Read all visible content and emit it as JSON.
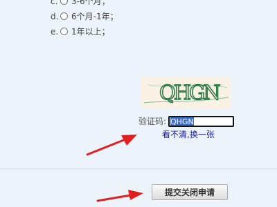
{
  "duration_options": [
    {
      "letter": "c.",
      "label": "3-6个月；"
    },
    {
      "letter": "d.",
      "label": "6个月-1年；"
    },
    {
      "letter": "e.",
      "label": "1年以上；"
    }
  ],
  "captcha": {
    "image_text": "QHGN",
    "label": "验证码:",
    "input_value": "QHGN",
    "refresh_link": "看不清,换一张"
  },
  "actions": {
    "submit_label": "提交关闭申请"
  },
  "colors": {
    "annotation_arrow": "#e02020",
    "captcha_text": "#2f7a46",
    "link": "#1a1ab0",
    "page_background": "#edf3fb"
  }
}
